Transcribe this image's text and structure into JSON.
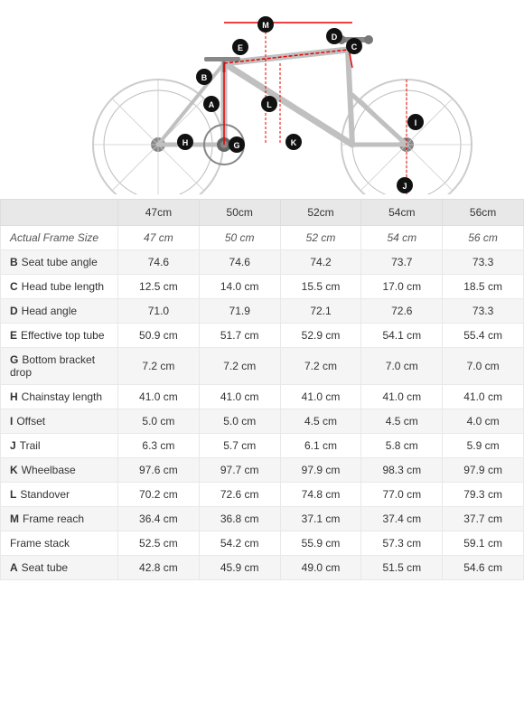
{
  "diagram": {
    "alt": "Road bike geometry diagram"
  },
  "table": {
    "headers": [
      "",
      "47cm",
      "50cm",
      "52cm",
      "54cm",
      "56cm"
    ],
    "rows": [
      {
        "label": "Actual Frame Size",
        "letter": "",
        "values": [
          "47 cm",
          "50 cm",
          "52 cm",
          "54 cm",
          "56 cm"
        ],
        "isActual": true
      },
      {
        "label": "Seat tube angle",
        "letter": "B",
        "values": [
          "74.6",
          "74.6",
          "74.2",
          "73.7",
          "73.3"
        ]
      },
      {
        "label": "Head tube length",
        "letter": "C",
        "values": [
          "12.5 cm",
          "14.0 cm",
          "15.5 cm",
          "17.0 cm",
          "18.5 cm"
        ]
      },
      {
        "label": "Head angle",
        "letter": "D",
        "values": [
          "71.0",
          "71.9",
          "72.1",
          "72.6",
          "73.3"
        ]
      },
      {
        "label": "Effective top tube",
        "letter": "E",
        "values": [
          "50.9 cm",
          "51.7 cm",
          "52.9 cm",
          "54.1 cm",
          "55.4 cm"
        ]
      },
      {
        "label": "Bottom bracket drop",
        "letter": "G",
        "values": [
          "7.2 cm",
          "7.2 cm",
          "7.2 cm",
          "7.0 cm",
          "7.0 cm"
        ]
      },
      {
        "label": "Chainstay length",
        "letter": "H",
        "values": [
          "41.0 cm",
          "41.0 cm",
          "41.0 cm",
          "41.0 cm",
          "41.0 cm"
        ]
      },
      {
        "label": "Offset",
        "letter": "I",
        "values": [
          "5.0 cm",
          "5.0 cm",
          "4.5 cm",
          "4.5 cm",
          "4.0 cm"
        ]
      },
      {
        "label": "Trail",
        "letter": "J",
        "values": [
          "6.3 cm",
          "5.7 cm",
          "6.1 cm",
          "5.8 cm",
          "5.9 cm"
        ]
      },
      {
        "label": "Wheelbase",
        "letter": "K",
        "values": [
          "97.6 cm",
          "97.7 cm",
          "97.9 cm",
          "98.3 cm",
          "97.9 cm"
        ]
      },
      {
        "label": "Standover",
        "letter": "L",
        "values": [
          "70.2 cm",
          "72.6 cm",
          "74.8 cm",
          "77.0 cm",
          "79.3 cm"
        ]
      },
      {
        "label": "Frame reach",
        "letter": "M",
        "values": [
          "36.4 cm",
          "36.8 cm",
          "37.1 cm",
          "37.4 cm",
          "37.7 cm"
        ]
      },
      {
        "label": "Frame stack",
        "letter": "",
        "values": [
          "52.5 cm",
          "54.2 cm",
          "55.9 cm",
          "57.3 cm",
          "59.1 cm"
        ]
      },
      {
        "label": "Seat tube",
        "letter": "A",
        "values": [
          "42.8 cm",
          "45.9 cm",
          "49.0 cm",
          "51.5 cm",
          "54.6 cm"
        ]
      }
    ]
  }
}
